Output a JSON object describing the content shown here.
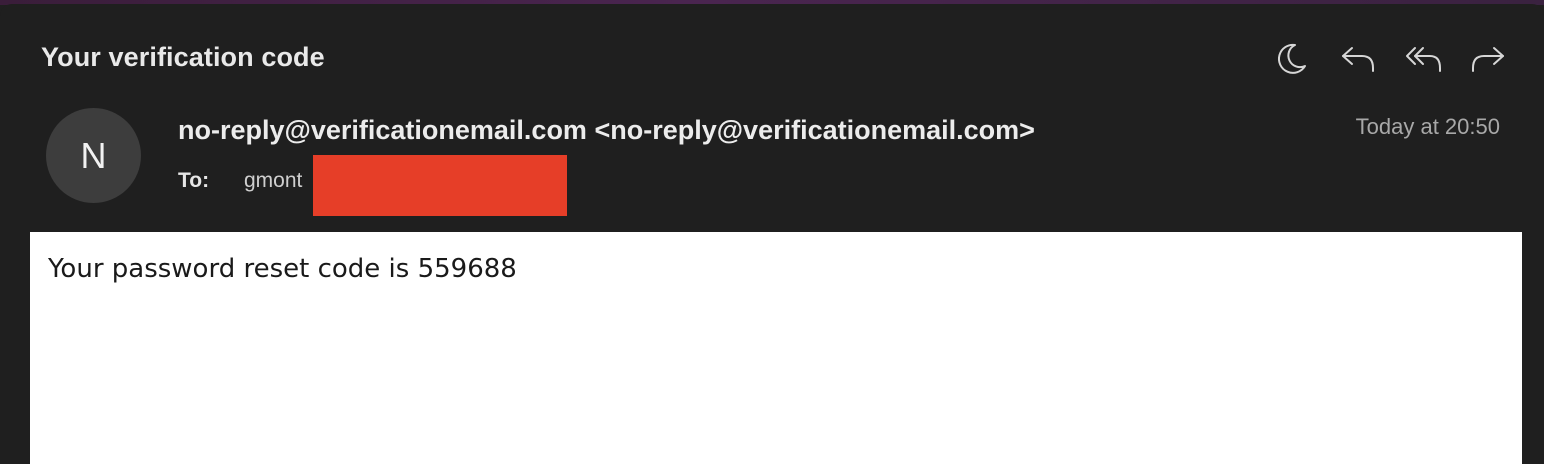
{
  "email": {
    "subject": "Your verification code",
    "sender_initial": "N",
    "from": "no-reply@verificationemail.com <no-reply@verificationemail.com>",
    "to_label": "To:",
    "to_value": "gmont",
    "date": "Today at 20:50",
    "body": "Your password reset code is 559688"
  },
  "toolbar": {
    "icons": [
      "moon-icon",
      "reply-icon",
      "reply-all-icon",
      "forward-icon"
    ]
  },
  "colors": {
    "background": "#1f1f1f",
    "avatar": "#3d3d3d",
    "redaction": "#e63e28",
    "body_background": "#ffffff"
  }
}
